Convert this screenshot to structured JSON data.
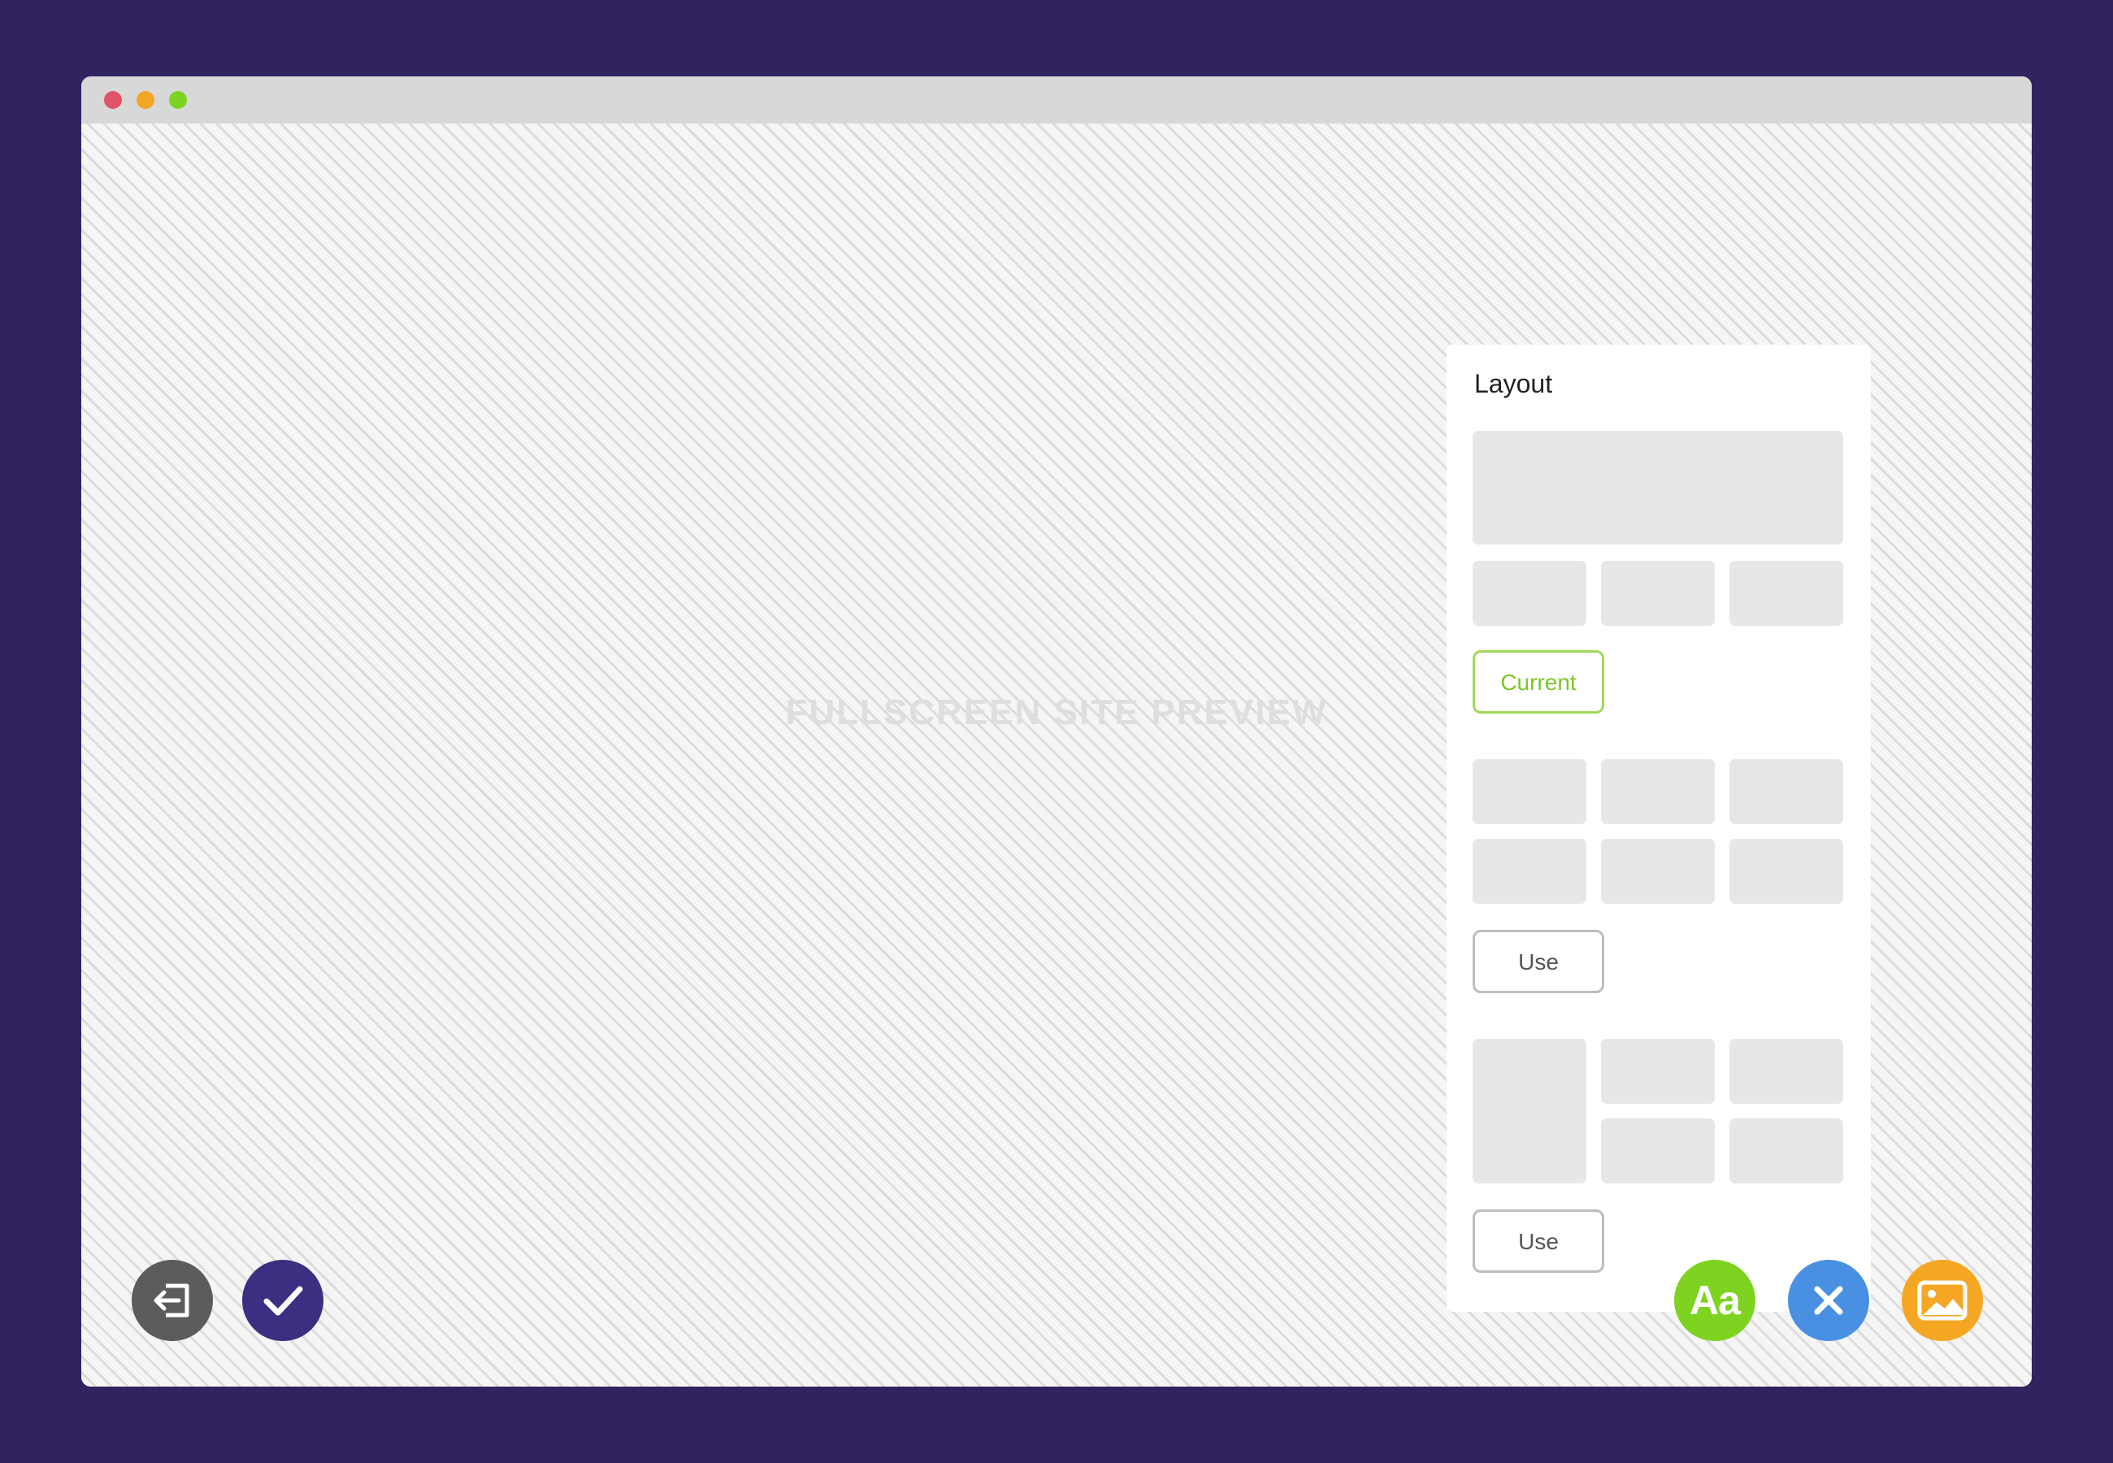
{
  "window": {
    "controls": [
      {
        "name": "close",
        "color": "#e0546a"
      },
      {
        "name": "minimize",
        "color": "#f4a523"
      },
      {
        "name": "maximize",
        "color": "#7ed321"
      }
    ]
  },
  "preview": {
    "label": "FULLSCREEN SITE PREVIEW"
  },
  "layout_panel": {
    "title": "Layout",
    "options": [
      {
        "button_label": "Current",
        "state": "current"
      },
      {
        "button_label": "Use",
        "state": "available"
      },
      {
        "button_label": "Use",
        "state": "available"
      }
    ]
  },
  "toolbar": {
    "left": [
      {
        "icon": "exit-icon",
        "color": "#5c5c5c"
      },
      {
        "icon": "check-icon",
        "color": "#3e2e82"
      }
    ],
    "right": [
      {
        "icon": "font-icon",
        "label": "Aa",
        "color": "#7ed321"
      },
      {
        "icon": "close-icon",
        "color": "#4a90e2"
      },
      {
        "icon": "image-icon",
        "color": "#f5a623"
      }
    ]
  },
  "colors": {
    "background": "#302360",
    "accent_green": "#7ed321",
    "accent_blue": "#4a90e2",
    "accent_orange": "#f5a623",
    "accent_purple": "#3e2e82"
  }
}
